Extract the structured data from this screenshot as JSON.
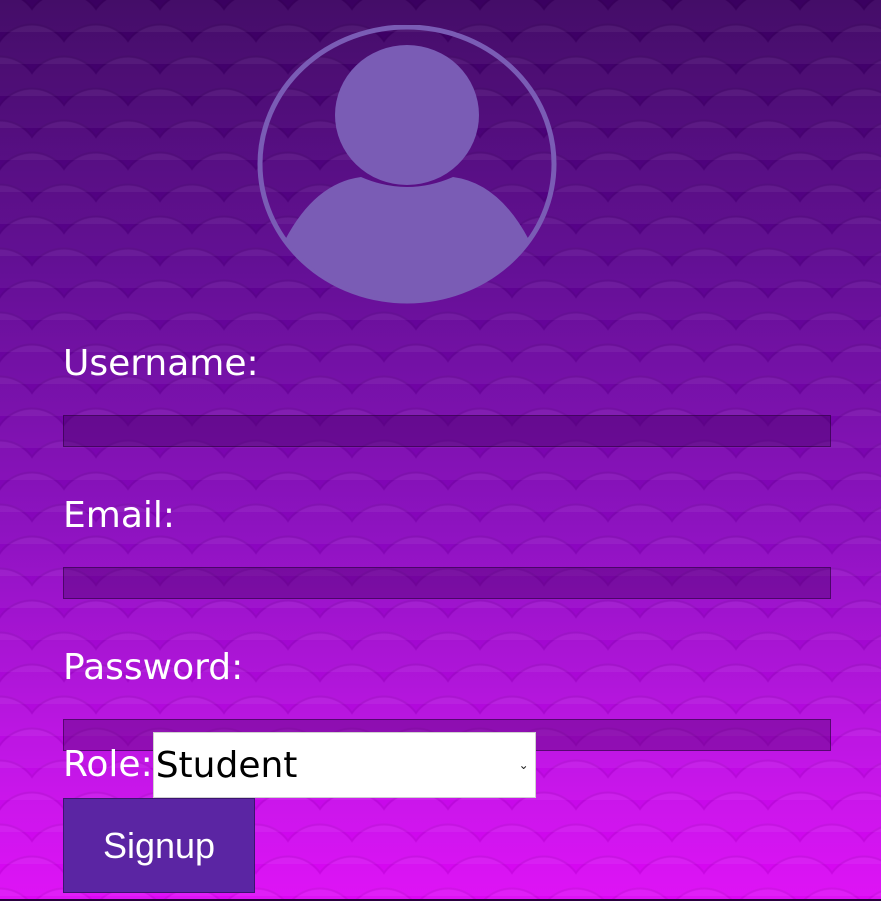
{
  "form": {
    "username_label": "Username:",
    "username_value": "",
    "email_label": "Email:",
    "email_value": "",
    "password_label": "Password:",
    "password_value": "",
    "role_label": "Role:",
    "role_selected": "Student",
    "signup_label": "Signup"
  },
  "icons": {
    "avatar": "user-avatar-icon",
    "select_arrow": "chevron-down-icon"
  },
  "colors": {
    "background_top": "#3a0060",
    "background_bottom": "#dd06f5",
    "avatar": "#7a5cb5",
    "button": "#5b25a3"
  }
}
